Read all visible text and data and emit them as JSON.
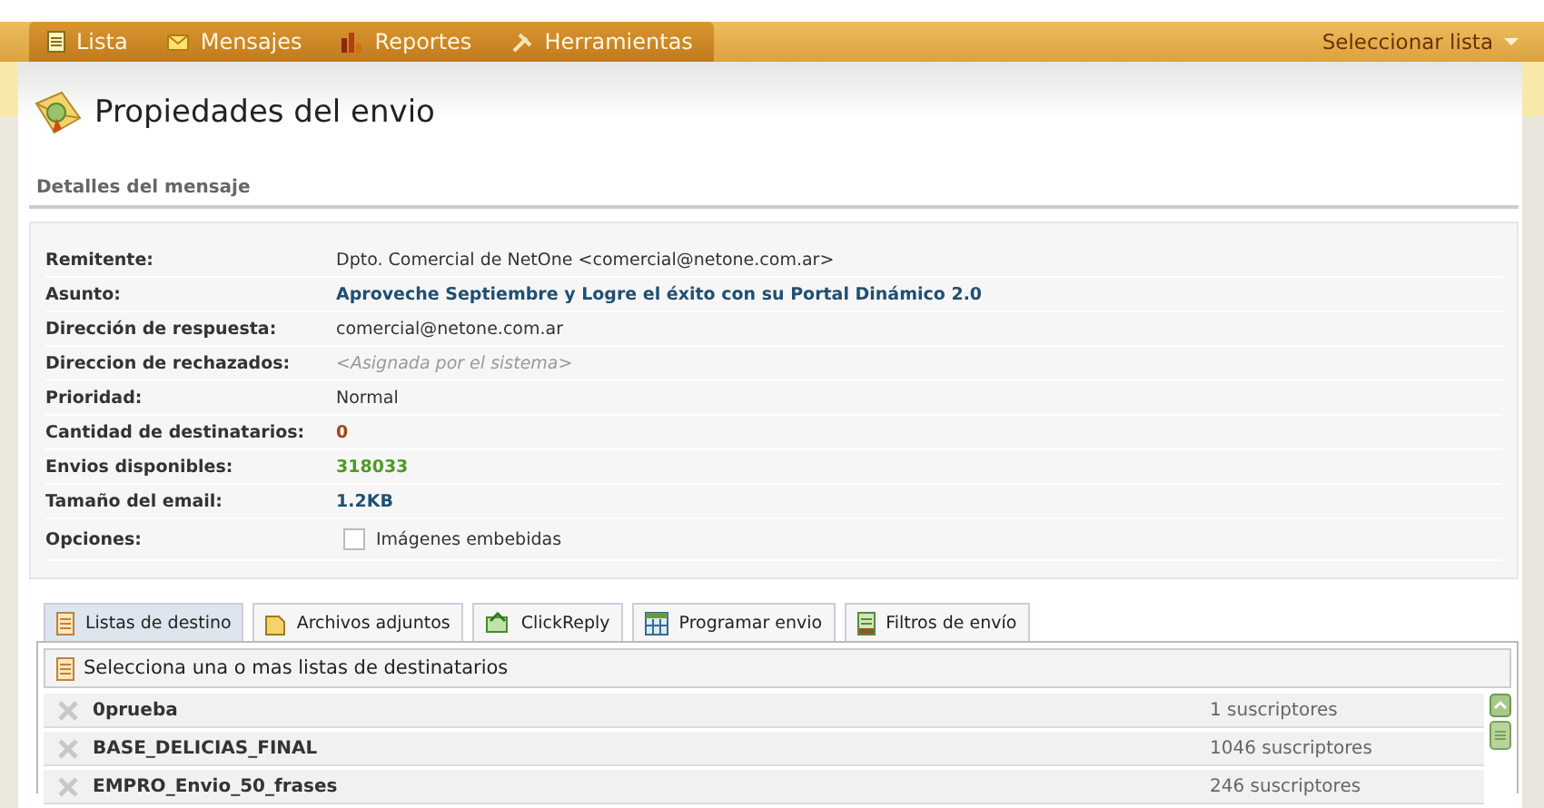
{
  "nav": {
    "tabs": [
      {
        "label": "Lista"
      },
      {
        "label": "Mensajes"
      },
      {
        "label": "Reportes"
      },
      {
        "label": "Herramientas"
      }
    ],
    "list_selector": "Seleccionar lista"
  },
  "page": {
    "title": "Propiedades del envio",
    "section": "Detalles del mensaje"
  },
  "details": [
    {
      "label": "Remitente:",
      "value": "Dpto. Comercial de NetOne <comercial@netone.com.ar>",
      "kind": "text"
    },
    {
      "label": "Asunto:",
      "value": "Aproveche Septiembre y Logre el éxito con su Portal Dinámico 2.0",
      "kind": "strong",
      "color": "#1f4f73"
    },
    {
      "label": "Dirección de respuesta:",
      "value": "comercial@netone.com.ar",
      "kind": "text"
    },
    {
      "label": "Direccion de rechazados:",
      "value": "<Asignada por el sistema>",
      "kind": "hint"
    },
    {
      "label": "Prioridad:",
      "value": "Normal",
      "kind": "text"
    },
    {
      "label": "Cantidad de destinatarios:",
      "value": "0",
      "kind": "strong",
      "color": "#a0461e"
    },
    {
      "label": "Envios disponibles:",
      "value": "318033",
      "kind": "strong",
      "color": "#4f9a2a"
    },
    {
      "label": "Tamaño del email:",
      "value": "1.2KB",
      "kind": "strong",
      "color": "#1f4f73"
    },
    {
      "label": "Opciones:",
      "value": "Imágenes embebidas",
      "kind": "checkbox",
      "checked": false
    }
  ],
  "tabs": [
    {
      "label": "Listas de destino",
      "selected": true
    },
    {
      "label": "Archivos adjuntos",
      "selected": false
    },
    {
      "label": "ClickReply",
      "selected": false
    },
    {
      "label": "Programar envio",
      "selected": false
    },
    {
      "label": "Filtros de envío",
      "selected": false
    }
  ],
  "lists_header": "Selecciona una o mas listas de destinatarios",
  "lists": [
    {
      "name": "0prueba",
      "subscribers": "1 suscriptores"
    },
    {
      "name": "BASE_DELICIAS_FINAL",
      "subscribers": "1046 suscriptores"
    },
    {
      "name": "EMPRO_Envio_50_frases",
      "subscribers": "246 suscriptores"
    }
  ]
}
